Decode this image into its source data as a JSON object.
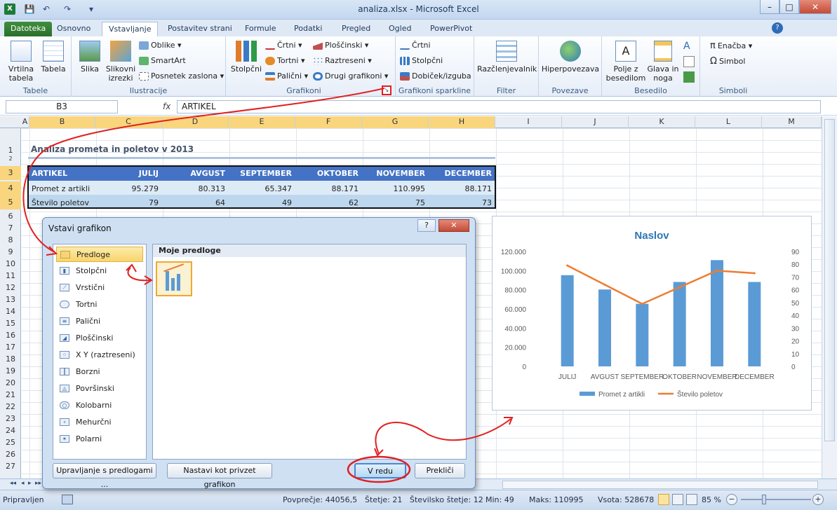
{
  "window": {
    "title": "analiza.xlsx - Microsoft Excel",
    "min": "–",
    "max": "□",
    "close": "✕"
  },
  "quick_access": {
    "excel_icon": "excel-icon",
    "save": "💾",
    "undo": "↶",
    "redo": "↷",
    "customize": "▾"
  },
  "tabs": [
    "Datoteka",
    "Osnovno",
    "Vstavljanje",
    "Postavitev strani",
    "Formule",
    "Podatki",
    "Pregled",
    "Ogled",
    "PowerPivot"
  ],
  "tab_help": "?",
  "ribbon": {
    "tabele": {
      "label": "Tabele",
      "pivot": "Vrtilna tabela",
      "table": "Tabela"
    },
    "ilustracije": {
      "label": "Ilustracije",
      "slika": "Slika",
      "slikovni": "Slikovni izrezki",
      "oblike": "Oblike",
      "smartart": "SmartArt",
      "posnetek": "Posnetek zaslona"
    },
    "grafikoni": {
      "label": "Grafikoni",
      "stolpcni": "Stolpčni",
      "crtni": "Črtni",
      "tortni": "Tortni",
      "palicni": "Palični",
      "ploscinski": "Ploščinski",
      "raztreseni": "Raztreseni",
      "drugi": "Drugi grafikoni"
    },
    "sparkline": {
      "label": "Grafikoni sparkline",
      "crtni": "Črtni",
      "stolpcni": "Stolpčni",
      "dobicek": "Dobiček/izguba"
    },
    "filter": {
      "label": "Filter",
      "razclenjevalnik": "Razčlenjevalnik"
    },
    "povezave": {
      "label": "Povezave",
      "hiper": "Hiperpovezava"
    },
    "besedilo": {
      "label": "Besedilo",
      "polje": "Polje z besedilom",
      "glava": "Glava in noga"
    },
    "simboli": {
      "label": "Simboli",
      "enacba": "Enačba",
      "simbol": "Simbol"
    }
  },
  "formula_bar": {
    "namebox": "B3",
    "fx": "fx",
    "value": "ARTIKEL"
  },
  "columns": [
    "A",
    "B",
    "C",
    "D",
    "E",
    "F",
    "G",
    "H",
    "I",
    "J",
    "K",
    "L",
    "M"
  ],
  "rows": [
    "1",
    "2",
    "3",
    "4",
    "5",
    "6",
    "7",
    "8",
    "9",
    "10",
    "11",
    "12",
    "13",
    "14",
    "15",
    "16",
    "17",
    "18",
    "19",
    "20",
    "21",
    "22",
    "23",
    "24",
    "25",
    "26",
    "27"
  ],
  "sheet": {
    "title": "Analiza prometa in poletov v 2013",
    "headers": [
      "ARTIKEL",
      "JULIJ",
      "AVGUST",
      "SEPTEMBER",
      "OKTOBER",
      "NOVEMBER",
      "DECEMBER"
    ],
    "rows": [
      [
        "Promet z artikli",
        "95.279",
        "80.313",
        "65.347",
        "88.171",
        "110.995",
        "88.171"
      ],
      [
        "Število poletov",
        "79",
        "64",
        "49",
        "62",
        "75",
        "73"
      ]
    ]
  },
  "dialog": {
    "title": "Vstavi grafikon",
    "help": "?",
    "close": "✕",
    "categories": [
      "Predloge",
      "Stolpčni",
      "Vrstični",
      "Tortni",
      "Palični",
      "Ploščinski",
      "X Y (raztreseni)",
      "Borzni",
      "Površinski",
      "Kolobarni",
      "Mehurčni",
      "Polarni"
    ],
    "right_header": "Moje predloge",
    "btn_manage": "Upravljanje s predlogami ...",
    "btn_default": "Nastavi kot privzet grafikon",
    "btn_ok": "V redu",
    "btn_cancel": "Prekliči"
  },
  "chart_data": {
    "type": "bar",
    "title": "Naslov",
    "categories": [
      "JULIJ",
      "AVGUST",
      "SEPTEMBER",
      "OKTOBER",
      "NOVEMBER",
      "DECEMBER"
    ],
    "series": [
      {
        "name": "Promet z artikli",
        "type": "bar",
        "axis": "left",
        "color": "#5b9bd5",
        "values": [
          95279,
          80313,
          65347,
          88171,
          110995,
          88171
        ]
      },
      {
        "name": "Število poletov",
        "type": "line",
        "axis": "right",
        "color": "#ed7d31",
        "values": [
          79,
          64,
          49,
          62,
          75,
          73
        ]
      }
    ],
    "y_left": {
      "min": 0,
      "max": 120000,
      "ticks": [
        "0",
        "20.000",
        "40.000",
        "60.000",
        "80.000",
        "100.000",
        "120.000"
      ]
    },
    "y_right": {
      "min": 0,
      "max": 90,
      "ticks": [
        "0",
        "10",
        "20",
        "30",
        "40",
        "50",
        "60",
        "70",
        "80",
        "90"
      ]
    },
    "legend": "bottom",
    "grid": false
  },
  "sheet_nav": [
    "◂◂",
    "◂",
    "▸",
    "▸▸"
  ],
  "status": {
    "ready": "Pripravljen",
    "avg": "Povprečje: 44056,5",
    "count": "Štetje: 21",
    "numcount": "Številsko štetje: 12",
    "min": "Min: 49",
    "max": "Maks: 110995",
    "sum": "Vsota: 528678",
    "zoom": "85 %",
    "zoom_minus": "−",
    "zoom_plus": "+"
  }
}
